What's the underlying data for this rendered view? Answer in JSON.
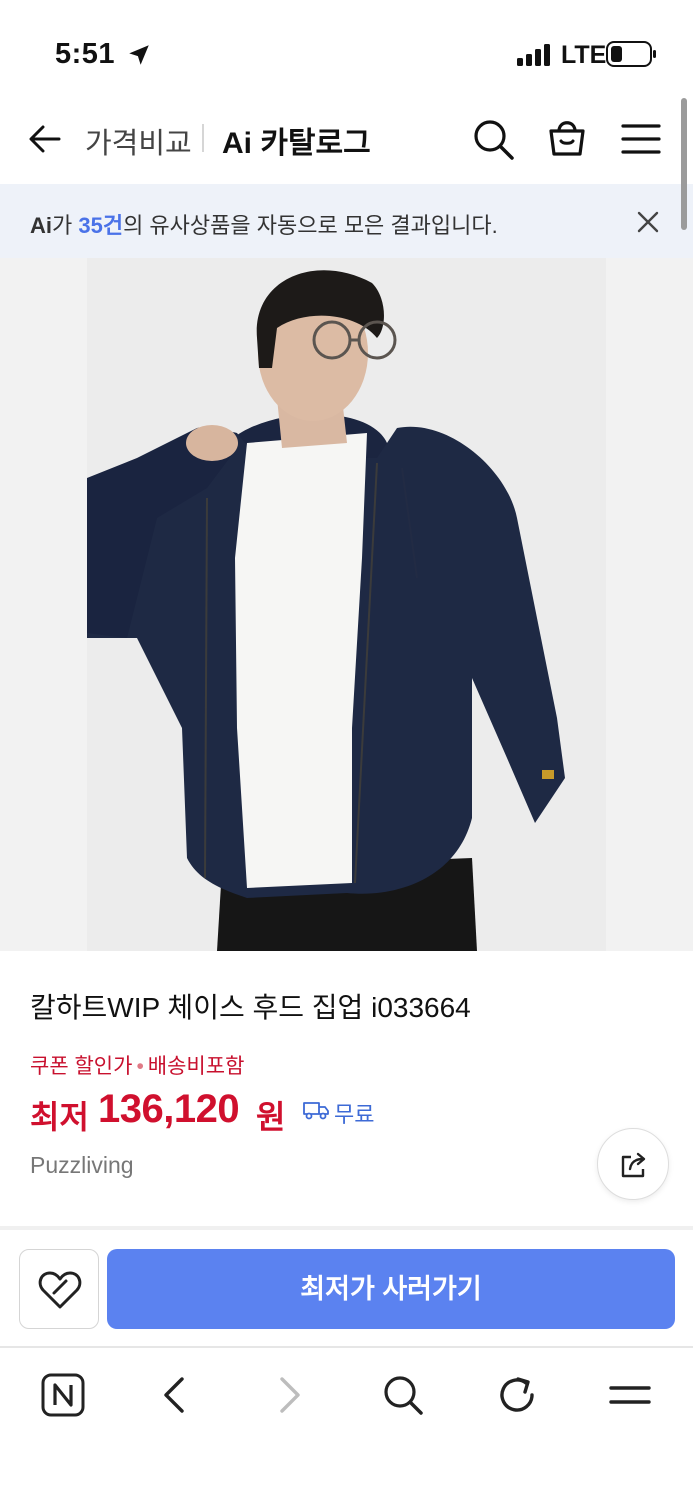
{
  "status_bar": {
    "time": "5:51",
    "network": "LTE",
    "icons": [
      "location-arrow-icon",
      "signal-icon",
      "battery-icon"
    ]
  },
  "header": {
    "prev_crumb": "가격비교",
    "current_crumb": "Ai 카탈로그",
    "icons": [
      "back-arrow-icon",
      "search-icon",
      "shopping-bag-icon",
      "hamburger-menu-icon"
    ]
  },
  "banner": {
    "prefix": "Ai",
    "before_count": "가 ",
    "count": "35건",
    "suffix": "의 유사상품을 자동으로 모은 결과입니다.",
    "close_icon": "close-icon"
  },
  "product": {
    "image_alt": "man wearing navy zip-up hoodie over white t-shirt",
    "title": "칼하트WIP 체이스 후드 집업 i033664",
    "tag_coupon": "쿠폰 할인가",
    "tag_separator": "•",
    "tag_shipping": "배송비포함",
    "price_label": "최저",
    "price_value": "136,120",
    "price_unit": "원",
    "shipping_label": "무료",
    "seller": "Puzzliving"
  },
  "actions": {
    "buy_label": "최저가 사러가기",
    "wish_icon": "heart-icon",
    "share_icon": "share-icon"
  },
  "colors": {
    "accent_blue": "#5b82f0",
    "price_red": "#d0102e",
    "banner_bg": "#eef2f9",
    "count_blue": "#4a72e8"
  },
  "browser_toolbar": {
    "icons": [
      "naver-home-icon",
      "back-chevron-icon",
      "forward-chevron-icon",
      "search-icon",
      "refresh-icon",
      "menu-icon"
    ]
  }
}
